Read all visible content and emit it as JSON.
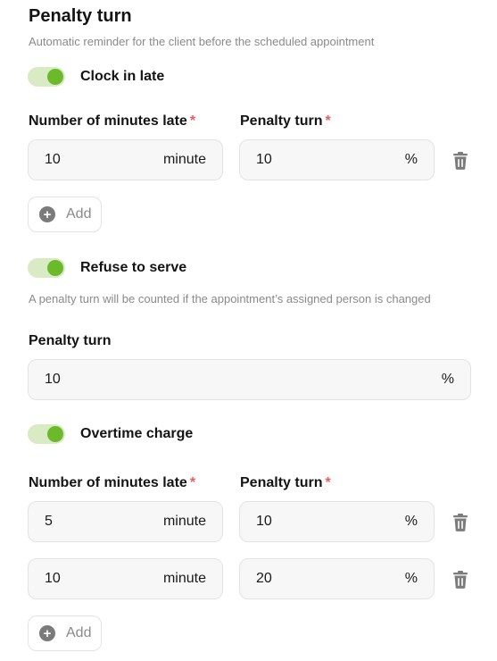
{
  "header": {
    "title": "Penalty turn",
    "subtitle": "Automatic reminder for the client before the scheduled appointment"
  },
  "clock_in_late": {
    "toggle_label": "Clock in late",
    "enabled": true,
    "minutes_label": "Number of minutes late",
    "penalty_label": "Penalty turn",
    "required_mark": "*",
    "rows": [
      {
        "minutes": "10",
        "minutes_unit": "minute",
        "penalty": "10",
        "penalty_unit": "%"
      }
    ],
    "add_label": "Add"
  },
  "refuse_to_serve": {
    "toggle_label": "Refuse to serve",
    "enabled": true,
    "note": "A penalty turn will be counted if the appointment’s assigned person is changed",
    "penalty_label": "Penalty turn",
    "penalty": "10",
    "penalty_unit": "%"
  },
  "overtime_charge": {
    "toggle_label": "Overtime charge",
    "enabled": true,
    "minutes_label": "Number of minutes late",
    "penalty_label": "Penalty turn",
    "required_mark": "*",
    "rows": [
      {
        "minutes": "5",
        "minutes_unit": "minute",
        "penalty": "10",
        "penalty_unit": "%"
      },
      {
        "minutes": "10",
        "minutes_unit": "minute",
        "penalty": "20",
        "penalty_unit": "%"
      }
    ],
    "add_label": "Add"
  },
  "icons": {
    "delete": "trash-icon",
    "add": "plus-circle-icon"
  },
  "colors": {
    "toggle_on": "#6cba2b",
    "toggle_track": "#d9ebc4",
    "required": "#ef5b5b"
  }
}
